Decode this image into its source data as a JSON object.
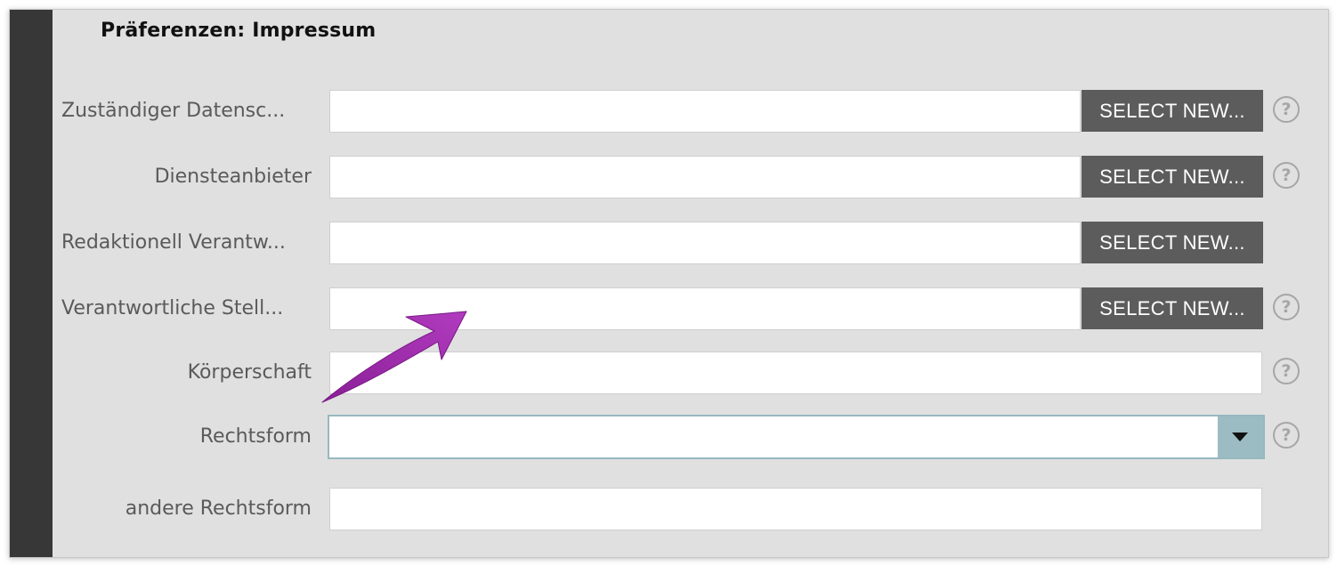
{
  "panel": {
    "title": "Präferenzen: Impressum"
  },
  "fields": [
    {
      "label": "Zuständiger Datensc...",
      "value": "",
      "button": "SELECT NEW...",
      "help": "?"
    },
    {
      "label": "Diensteanbieter",
      "value": "",
      "button": "SELECT NEW...",
      "help": "?"
    },
    {
      "label": "Redaktionell Verantw...",
      "value": "",
      "button": "SELECT NEW..."
    },
    {
      "label": "Verantwortliche Stell...",
      "value": "",
      "button": "SELECT NEW...",
      "help": "?"
    },
    {
      "label": "Körperschaft",
      "value": "",
      "help": "?"
    },
    {
      "label": "Rechtsform",
      "value": "",
      "help": "?"
    },
    {
      "label": "andere Rechtsform",
      "value": ""
    }
  ],
  "colors": {
    "sidebar_strip": "#373737",
    "panel_background": "#e0e0e0",
    "button_background": "#5c5c5c",
    "dropdown_accent": "#9bbcc2",
    "annotation_arrow": "#9b2aa6"
  },
  "icons": {
    "help": "question-circle-icon",
    "dropdown": "caret-down-icon",
    "annotation": "annotation-arrow-icon"
  }
}
